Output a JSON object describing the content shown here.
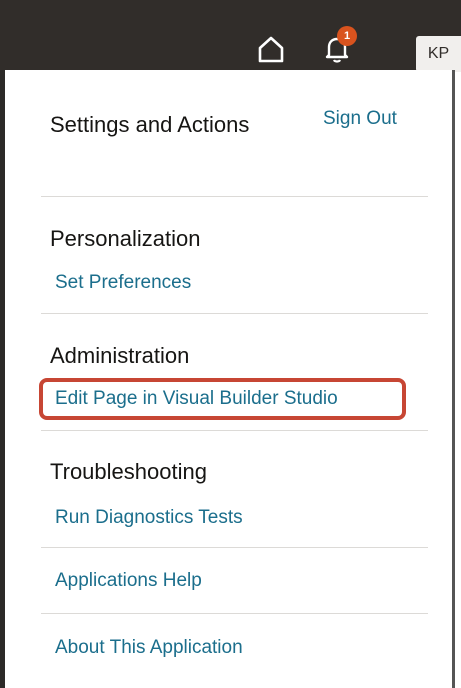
{
  "header": {
    "home_icon": "home-icon",
    "notifications_icon": "bell-icon",
    "notification_count": "1",
    "user_initials": "KP"
  },
  "menu": {
    "title": "Settings and Actions",
    "sign_out": "Sign Out",
    "sections": {
      "personalization": {
        "title": "Personalization",
        "link": "Set Preferences"
      },
      "administration": {
        "title": "Administration",
        "link": "Edit Page in Visual Builder Studio"
      },
      "troubleshooting": {
        "title": "Troubleshooting",
        "link": "Run Diagnostics Tests"
      }
    },
    "applications_help": "Applications Help",
    "about_application": "About This Application"
  },
  "colors": {
    "topbar": "#312d2a",
    "link": "#1b6e8c",
    "badge": "#d9531e",
    "highlight": "#c74634"
  }
}
